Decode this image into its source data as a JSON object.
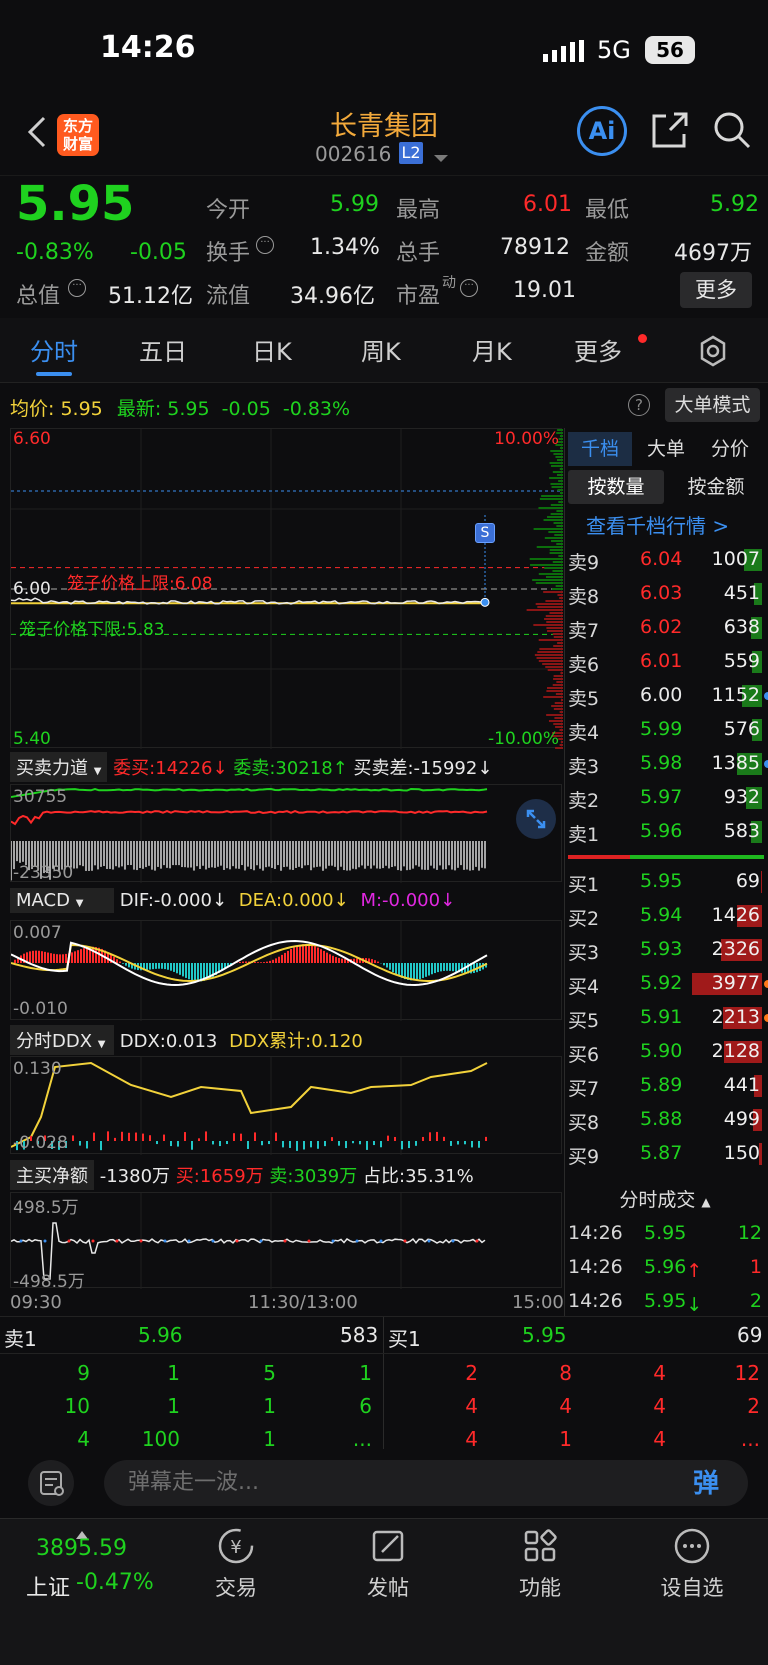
{
  "status": {
    "time": "14:26",
    "network": "5G",
    "battery": "56"
  },
  "header": {
    "title": "长青集团",
    "code": "002616",
    "level_badge": "L2",
    "logo_text_1": "东方",
    "logo_text_2": "财富",
    "ai_label": "Ai"
  },
  "quote": {
    "price": "5.95",
    "change_pct": "-0.83%",
    "change": "-0.05",
    "open_label": "今开",
    "open": "5.99",
    "high_label": "最高",
    "high": "6.01",
    "low_label": "最低",
    "low": "5.92",
    "turnover_label": "换手",
    "turnover": "1.34%",
    "volume_label": "总手",
    "volume": "78912",
    "amount_label": "金额",
    "amount": "4697万",
    "mktcap_label": "总值",
    "mktcap": "51.12亿",
    "float_label": "流值",
    "float": "34.96亿",
    "pe_label": "市盈",
    "pe_sup": "动",
    "pe": "19.01",
    "more": "更多"
  },
  "tabs": [
    "分时",
    "五日",
    "日K",
    "周K",
    "月K",
    "更多"
  ],
  "info_line": {
    "avg_label": "均价:",
    "avg": "5.95",
    "latest_label": "最新:",
    "latest": "5.95",
    "chg": "-0.05",
    "pct": "-0.83%",
    "big_order": "大单模式"
  },
  "main_chart": {
    "y_top": "6.60",
    "y_mid": "6.00",
    "y_bottom": "5.40",
    "pct_top": "10.00%",
    "pct_bottom": "-10.00%",
    "cage_upper": "笼子价格上限:6.08",
    "cage_lower": "笼子价格下限:5.83",
    "s_marker": "S",
    "x_start": "09:30",
    "x_mid": "11:30/13:00",
    "x_end": "15:00",
    "mid_value": 6.0,
    "cage_upper_value": 6.08,
    "cage_lower_value": 5.83,
    "avg_value": 5.95,
    "ylim": [
      5.4,
      6.6
    ]
  },
  "bs_power": {
    "label": "买卖力道",
    "buy": "委买:14226",
    "buy_arrow": "↓",
    "sell": "委卖:30218",
    "sell_arrow": "↑",
    "diff": "买卖差:-15992",
    "diff_arrow": "↓",
    "y_top": "30755",
    "y_bottom": "-23350"
  },
  "macd": {
    "label": "MACD",
    "dif": "DIF:-0.000",
    "dif_arrow": "↓",
    "dea": "DEA:0.000",
    "dea_arrow": "↓",
    "m": "M:-0.000",
    "m_arrow": "↓",
    "y_top": "0.007",
    "y_bottom": "-0.010"
  },
  "ddx": {
    "label": "分时DDX",
    "ddx": "DDX:0.013",
    "ddx_cum": "DDX累计:0.120",
    "y_top": "0.130",
    "y_bottom": "-0.028"
  },
  "netbuy": {
    "label": "主买净额",
    "net": "-1380万",
    "buy": "买:1659万",
    "sell": "卖:3039万",
    "ratio": "占比:35.31%",
    "y_top": "498.5万",
    "y_bottom": "-498.5万"
  },
  "orderbook": {
    "tabs": [
      "千档",
      "大单",
      "分价"
    ],
    "sub_tabs": [
      "按数量",
      "按金额"
    ],
    "link": "查看千档行情 >",
    "asks": [
      {
        "label": "卖9",
        "price": "6.04",
        "qty": "1007",
        "color": "#ff2a2a",
        "bar": 0.25
      },
      {
        "label": "卖8",
        "price": "6.03",
        "qty": "451",
        "color": "#ff2a2a",
        "bar": 0.12
      },
      {
        "label": "卖7",
        "price": "6.02",
        "qty": "638",
        "color": "#ff2a2a",
        "bar": 0.16
      },
      {
        "label": "卖6",
        "price": "6.01",
        "qty": "559",
        "color": "#ff2a2a",
        "bar": 0.14
      },
      {
        "label": "卖5",
        "price": "6.00",
        "qty": "1152",
        "color": "#e8e8e8",
        "bar": 0.29,
        "dot": "#3b8ff0"
      },
      {
        "label": "卖4",
        "price": "5.99",
        "qty": "576",
        "color": "#1fd21f",
        "bar": 0.14
      },
      {
        "label": "卖3",
        "price": "5.98",
        "qty": "1385",
        "color": "#1fd21f",
        "bar": 0.35,
        "dot": "#3b8ff0"
      },
      {
        "label": "卖2",
        "price": "5.97",
        "qty": "932",
        "color": "#1fd21f",
        "bar": 0.23
      },
      {
        "label": "卖1",
        "price": "5.96",
        "qty": "583",
        "color": "#1fd21f",
        "bar": 0.15
      }
    ],
    "bids": [
      {
        "label": "买1",
        "price": "5.95",
        "qty": "69",
        "color": "#1fd21f",
        "bar": 0.02
      },
      {
        "label": "买2",
        "price": "5.94",
        "qty": "1426",
        "color": "#1fd21f",
        "bar": 0.36
      },
      {
        "label": "买3",
        "price": "5.93",
        "qty": "2326",
        "color": "#1fd21f",
        "bar": 0.58
      },
      {
        "label": "买4",
        "price": "5.92",
        "qty": "3977",
        "color": "#1fd21f",
        "bar": 1.0,
        "dot": "#ff7a1a"
      },
      {
        "label": "买5",
        "price": "5.91",
        "qty": "2213",
        "color": "#1fd21f",
        "bar": 0.56,
        "dot": "#ff7a1a"
      },
      {
        "label": "买6",
        "price": "5.90",
        "qty": "2128",
        "color": "#1fd21f",
        "bar": 0.54
      },
      {
        "label": "买7",
        "price": "5.89",
        "qty": "441",
        "color": "#1fd21f",
        "bar": 0.11
      },
      {
        "label": "买8",
        "price": "5.88",
        "qty": "499",
        "color": "#1fd21f",
        "bar": 0.13
      },
      {
        "label": "买9",
        "price": "5.87",
        "qty": "150",
        "color": "#1fd21f",
        "bar": 0.04
      }
    ]
  },
  "trades": {
    "label": "分时成交",
    "rows": [
      {
        "time": "14:26",
        "price": "5.95",
        "vol": "12",
        "color": "#1fd21f",
        "arrow": "",
        "volcolor": "#1fd21f"
      },
      {
        "time": "14:26",
        "price": "5.96",
        "vol": "1",
        "color": "#1fd21f",
        "arrow": "↑",
        "volcolor": "#ff2a2a"
      },
      {
        "time": "14:26",
        "price": "5.95",
        "vol": "2",
        "color": "#1fd21f",
        "arrow": "↓",
        "volcolor": "#1fd21f"
      }
    ]
  },
  "queue": {
    "sell_label": "卖1",
    "sell_price": "5.96",
    "sell_qty": "583",
    "buy_label": "买1",
    "buy_price": "5.95",
    "buy_qty": "69",
    "sell_rows": [
      [
        "9",
        "1",
        "5",
        "1"
      ],
      [
        "10",
        "1",
        "1",
        "6"
      ],
      [
        "4",
        "100",
        "1",
        "..."
      ]
    ],
    "buy_rows": [
      [
        "2",
        "8",
        "4",
        "12"
      ],
      [
        "4",
        "4",
        "4",
        "2"
      ],
      [
        "4",
        "1",
        "4",
        "..."
      ]
    ]
  },
  "danmaku": {
    "placeholder": "弹幕走一波...",
    "send": "弹"
  },
  "bottom_nav": {
    "index_value": "3895.59",
    "index_name": "上证",
    "index_change": "-0.47%",
    "items": [
      "交易",
      "发帖",
      "功能",
      "设自选"
    ]
  },
  "colors": {
    "up": "#ff2a2a",
    "down": "#1fd21f",
    "accent": "#3b8ff0",
    "brand": "#ff5a1f",
    "title": "#f2a93b"
  }
}
